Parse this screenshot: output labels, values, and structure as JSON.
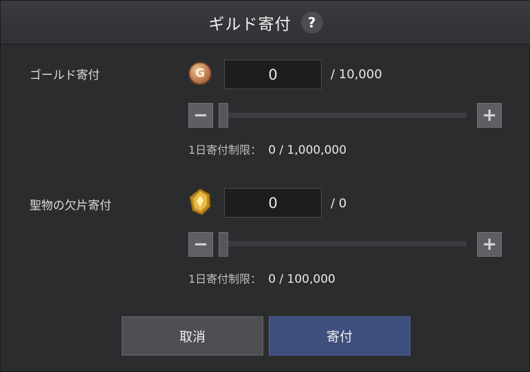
{
  "dialog": {
    "title": "ギルド寄付",
    "help_icon": "?"
  },
  "gold": {
    "label": "ゴールド寄付",
    "icon": "gold-coin-icon",
    "coin_letter": "G",
    "value": "0",
    "max": "/ 10,000",
    "slider_fraction": 0,
    "limit_label": "1日寄付制限：",
    "limit_value": "0 / 1,000,000"
  },
  "relic": {
    "label": "聖物の欠片寄付",
    "icon": "relic-fragment-icon",
    "value": "0",
    "max": "/ 0",
    "slider_fraction": 0,
    "limit_label": "1日寄付制限：",
    "limit_value": "0 / 100,000"
  },
  "buttons": {
    "minus": "−",
    "plus": "+",
    "cancel": "取消",
    "donate": "寄付"
  }
}
